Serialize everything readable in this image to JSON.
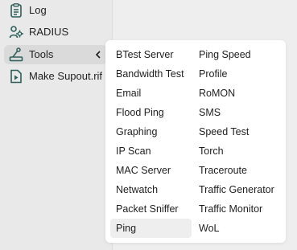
{
  "sidebar": {
    "items": [
      {
        "label": "Log",
        "icon": "log-icon"
      },
      {
        "label": "RADIUS",
        "icon": "radius-icon"
      },
      {
        "label": "Tools",
        "icon": "tools-icon",
        "expanded": true
      },
      {
        "label": "Make Supout.rif",
        "icon": "supout-icon"
      }
    ]
  },
  "tools_menu": {
    "column1": [
      "BTest Server",
      "Bandwidth Test",
      "Email",
      "Flood Ping",
      "Graphing",
      "IP Scan",
      "MAC Server",
      "Netwatch",
      "Packet Sniffer",
      "Ping"
    ],
    "column2": [
      "Ping Speed",
      "Profile",
      "RoMON",
      "SMS",
      "Speed Test",
      "Torch",
      "Traceroute",
      "Traffic Generator",
      "Traffic Monitor",
      "WoL"
    ],
    "highlighted": "Ping"
  },
  "colors": {
    "icon_accent": "#2f5f5a",
    "background": "#eeeeee",
    "menu_background": "#ffffff"
  }
}
